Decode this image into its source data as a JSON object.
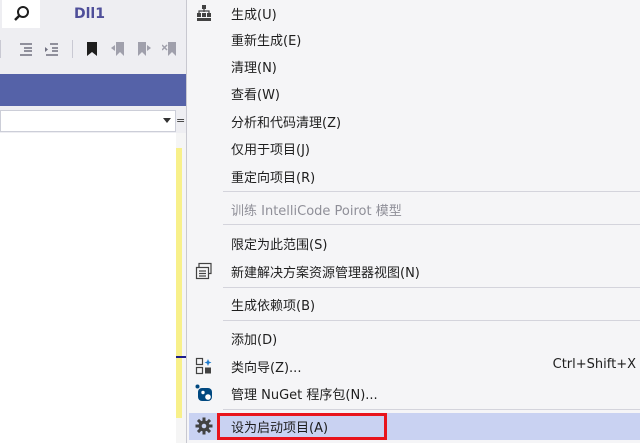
{
  "ide": {
    "tab_title": "Dll1",
    "search_icon": "search-icon",
    "split_indicator": "=",
    "colors": {
      "header_band": "#5562a8",
      "gutter_change": "#f8f08a"
    }
  },
  "menu": {
    "items": [
      {
        "label": "生成(U)",
        "icon": "build-icon"
      },
      {
        "label": "重新生成(E)"
      },
      {
        "label": "清理(N)"
      },
      {
        "label": "查看(W)"
      },
      {
        "label": "分析和代码清理(Z)"
      },
      {
        "label": "仅用于项目(J)"
      },
      {
        "label": "重定向项目(R)"
      },
      {
        "label": "训练 IntelliCode Poirot 模型",
        "disabled": true
      },
      {
        "label": "限定为此范围(S)"
      },
      {
        "label": "新建解决方案资源管理器视图(N)",
        "icon": "new-window-icon"
      },
      {
        "label": "生成依赖项(B)"
      },
      {
        "label": "添加(D)"
      },
      {
        "label": "类向导(Z)...",
        "icon": "class-wizard-icon",
        "shortcut": "Ctrl+Shift+X"
      },
      {
        "label": "管理 NuGet 程序包(N)...",
        "icon": "nuget-icon"
      },
      {
        "label": "设为启动项目(A)",
        "icon": "gear-icon",
        "highlighted": true
      }
    ],
    "colors": {
      "highlight": "#c9d2f2",
      "annotation_box": "#e8141c"
    }
  }
}
